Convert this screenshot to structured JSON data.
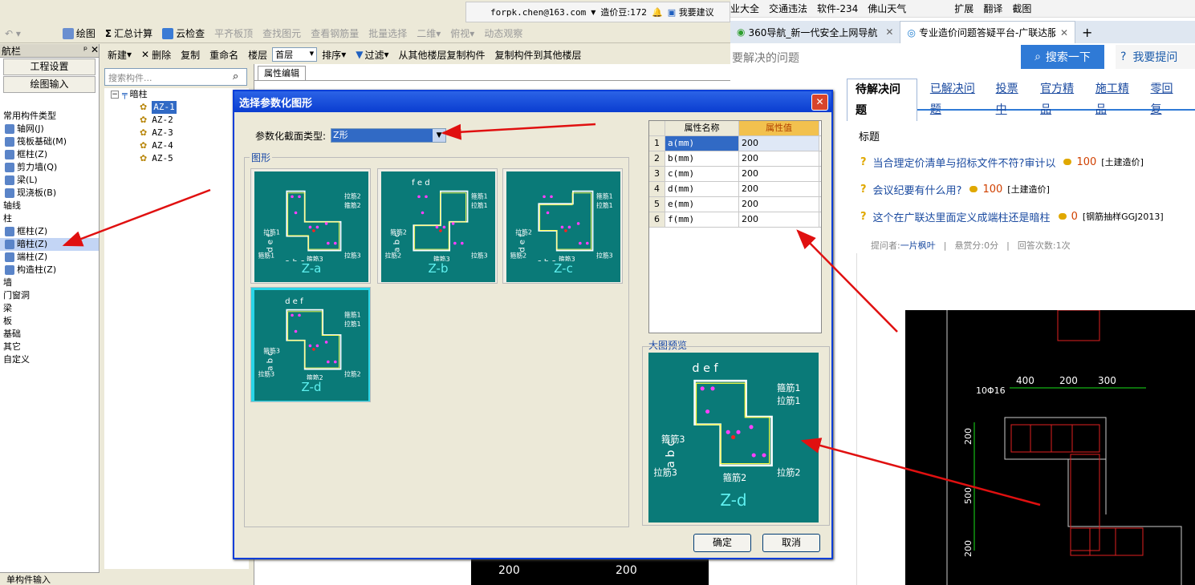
{
  "left_app": {
    "top_info": {
      "account": "forpk.chen@163.com",
      "beans": "造价豆:172",
      "suggest": "我要建议"
    },
    "toolbar1": [
      "绘图",
      "汇总计算",
      "云检查",
      "平齐板顶",
      "查找图元",
      "查看钢筋量",
      "批量选择",
      "二维",
      "俯视",
      "动态观察"
    ],
    "toolbar2": {
      "new": "新建",
      "delete": "删除",
      "copy": "复制",
      "rename": "重命名",
      "floor_label": "楼层",
      "floor_value": "首层",
      "sort": "排序",
      "filter": "过滤",
      "copy_from": "从其他楼层复制构件",
      "copy_to": "复制构件到其他楼层"
    },
    "nav": {
      "title": "航栏",
      "buttons": [
        "工程设置",
        "绘图输入"
      ],
      "items": [
        "常用构件类型",
        "轴网(J)",
        "筏板基础(M)",
        "框柱(Z)",
        "剪力墙(Q)",
        "梁(L)",
        "现浇板(B)",
        "轴线",
        "柱",
        "框柱(Z)",
        "暗柱(Z)",
        "端柱(Z)",
        "构造柱(Z)",
        "墙",
        "门窗洞",
        "梁",
        "板",
        "基础",
        "其它",
        "自定义"
      ],
      "footer": "单构件输入"
    },
    "search_placeholder": "搜索构件...",
    "tree": {
      "root": "暗柱",
      "children": [
        "AZ-1",
        "AZ-2",
        "AZ-3",
        "AZ-4",
        "AZ-5"
      ]
    },
    "prop_tab": "属性编辑",
    "bottom_dims": [
      "200",
      "200"
    ]
  },
  "browser": {
    "bookmarks": [
      "业大全",
      "交通违法",
      "软件-234",
      "佛山天气",
      "扩展",
      "翻译",
      "截图"
    ],
    "tabs": [
      "360导航_新一代安全上网导航",
      "专业造价问题答疑平台-广联达服"
    ],
    "search_placeholder": "要解决的问题",
    "search_button": "搜索一下",
    "ask_button": "我要提问",
    "question_tabs": [
      "待解决问题",
      "已解决问题",
      "投票中",
      "官方精品",
      "施工精品",
      "零回复"
    ],
    "list_header": "标题",
    "questions": [
      {
        "title": "当合理定价清单与招标文件不符?审计以",
        "bounty": "100",
        "tag": "[土建造价]"
      },
      {
        "title": "会议纪要有什么用?",
        "bounty": "100",
        "tag": "[土建造价]"
      },
      {
        "title": "这个在广联达里面定义成端柱还是暗柱",
        "bounty": "0",
        "tag": "[钢筋抽样GGJ2013]"
      }
    ],
    "meta": {
      "asker_label": "提问者:",
      "asker": "一片枫叶",
      "reward": "悬赏分:0分",
      "answers": "回答次数:1次"
    },
    "cad": {
      "rebar": "10Φ16",
      "top_dims": [
        "400",
        "200",
        "300"
      ],
      "side_dims": [
        "200",
        "500",
        "200"
      ]
    }
  },
  "dialog": {
    "title": "选择参数化图形",
    "section_type_label": "参数化截面类型:",
    "section_type_value": "Z形",
    "group_label": "图形",
    "shapes": [
      {
        "label": "Z-a",
        "top_dims": "",
        "bottom_dims": "a b c",
        "side_dims": "d e f",
        "notes": [
          "拉筋2",
          "箍筋2",
          "箍筋1",
          "拉筋1",
          "箍筋3",
          "拉筋3"
        ]
      },
      {
        "label": "Z-b",
        "top_dims": "f e d",
        "bottom_dims": "",
        "side_dims": "a b c",
        "notes": [
          "箍筋1",
          "拉筋1",
          "拉筋2",
          "箍筋2",
          "箍筋3",
          "拉筋3"
        ]
      },
      {
        "label": "Z-c",
        "top_dims": "",
        "bottom_dims": "c b a",
        "side_dims": "d e f",
        "notes": [
          "箍筋1",
          "拉筋1",
          "箍筋2",
          "拉筋2",
          "箍筋3",
          "拉筋3"
        ]
      },
      {
        "label": "Z-d",
        "top_dims": "d e f",
        "bottom_dims": "",
        "side_dims": "a b c",
        "notes": [
          "箍筋1",
          "拉筋1",
          "拉筋3",
          "箍筋3",
          "箍筋2",
          "拉筋2"
        ]
      }
    ],
    "selected_shape": "Z-d",
    "table": {
      "headers": [
        "属性名称",
        "属性值"
      ],
      "rows": [
        {
          "no": "1",
          "name": "a(mm)",
          "value": "200"
        },
        {
          "no": "2",
          "name": "b(mm)",
          "value": "200"
        },
        {
          "no": "3",
          "name": "c(mm)",
          "value": "200"
        },
        {
          "no": "4",
          "name": "d(mm)",
          "value": "200"
        },
        {
          "no": "5",
          "name": "e(mm)",
          "value": "200"
        },
        {
          "no": "6",
          "name": "f(mm)",
          "value": "200"
        }
      ]
    },
    "preview_label": "大图预览",
    "preview": {
      "title": "Z-d",
      "top_dims": "d e f",
      "side_dims": "a b c",
      "notes": [
        "箍筋1",
        "拉筋1",
        "拉筋3",
        "箍筋3",
        "箍筋2",
        "拉筋2"
      ]
    },
    "ok": "确定",
    "cancel": "取消"
  },
  "colors": {
    "teal": "#0a7a78",
    "title_blue": "#0a3ed8",
    "arrow_red": "#e01010",
    "link_blue": "#1a4aa0"
  }
}
